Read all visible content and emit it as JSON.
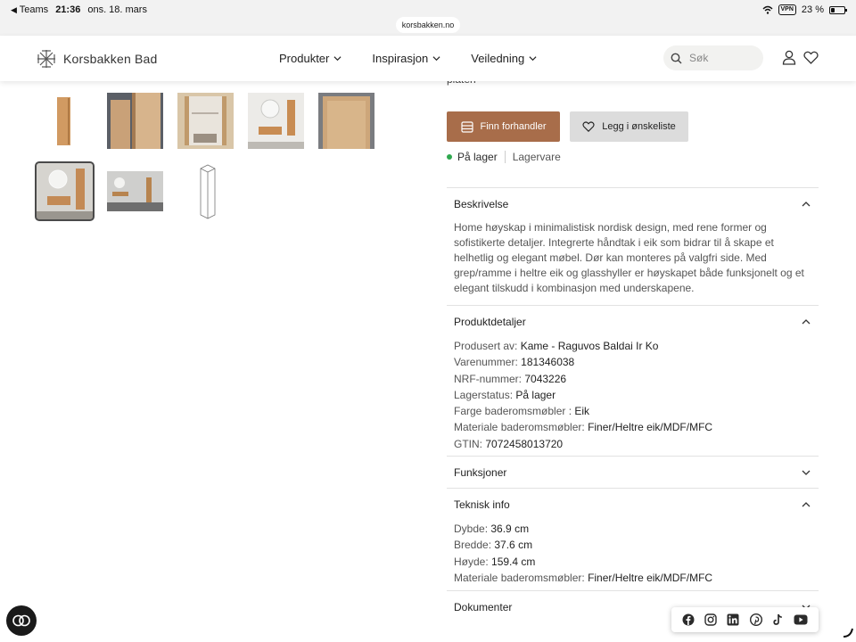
{
  "status_bar": {
    "back_app": "Teams",
    "time": "21:36",
    "date": "ons. 18. mars",
    "url": "korsbakken.no",
    "vpn": "VPN",
    "battery": "23 %"
  },
  "header": {
    "logo_text": "Korsbakken Bad",
    "nav": [
      {
        "label": "Produkter"
      },
      {
        "label": "Inspirasjon"
      },
      {
        "label": "Veiledning"
      }
    ],
    "search_placeholder": "Søk",
    "icons": [
      "user-icon",
      "heart-icon"
    ]
  },
  "gallery": {
    "thumbnails": [
      {
        "name": "thumb-cabinet-front"
      },
      {
        "name": "thumb-cabinet-open-side"
      },
      {
        "name": "thumb-cabinet-interior"
      },
      {
        "name": "thumb-bathroom-mirror"
      },
      {
        "name": "thumb-door-detail"
      },
      {
        "name": "thumb-bathroom-set",
        "selected": true
      },
      {
        "name": "thumb-bathroom-wide"
      },
      {
        "name": "thumb-line-drawing"
      }
    ]
  },
  "product": {
    "partial_text": "platen",
    "buttons": {
      "find_dealer": "Finn forhandler",
      "wishlist": "Legg i ønskeliste"
    },
    "stock": {
      "status": "På lager",
      "type": "Lagervare",
      "status_color": "#2fa84f"
    },
    "accent_color": "#a86d4a"
  },
  "sections": {
    "description": {
      "title": "Beskrivelse",
      "expanded": true,
      "lines": [
        "Home høyskap i minimalistisk nordisk design, med rene former og",
        "sofistikerte detaljer. Integrerte håndtak i eik som bidrar til å skape et",
        "helhetlig og elegant møbel. Dør kan monteres på valgfri side. Med",
        "grep/ramme i heltre eik og glasshyller er høyskapet både funksjonelt og et",
        "elegant tilskudd i kombinasjon med underskapene."
      ]
    },
    "details": {
      "title": "Produktdetaljer",
      "expanded": true,
      "rows": [
        {
          "label": "Produsert av:",
          "value": "Kame - Raguvos Baldai Ir Ko"
        },
        {
          "label": "Varenummer:",
          "value": "181346038"
        },
        {
          "label": "NRF-nummer:",
          "value": "7043226"
        },
        {
          "label": "Lagerstatus:",
          "value": "På lager"
        },
        {
          "label": "Farge baderomsmøbler :",
          "value": "Eik"
        },
        {
          "label": "Materiale baderomsmøbler:",
          "value": "Finer/Heltre eik/MDF/MFC"
        },
        {
          "label": "GTIN:",
          "value": "7072458013720"
        }
      ]
    },
    "functions": {
      "title": "Funksjoner",
      "expanded": false
    },
    "technical": {
      "title": "Teknisk info",
      "expanded": true,
      "rows": [
        {
          "label": "Dybde:",
          "value": "36.9 cm"
        },
        {
          "label": "Bredde:",
          "value": "37.6 cm"
        },
        {
          "label": "Høyde:",
          "value": "159.4 cm"
        },
        {
          "label": "Materiale baderomsmøbler:",
          "value": "Finer/Heltre eik/MDF/MFC"
        }
      ]
    },
    "documents": {
      "title": "Dokumenter",
      "expanded": false
    }
  },
  "social": [
    "facebook-icon",
    "instagram-icon",
    "linkedin-icon",
    "pinterest-icon",
    "tiktok-icon",
    "youtube-icon"
  ]
}
